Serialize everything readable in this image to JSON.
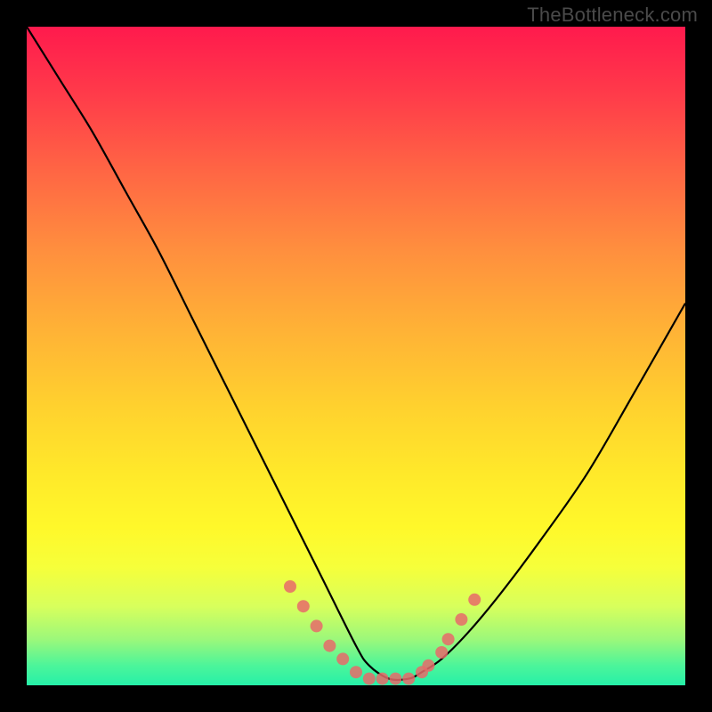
{
  "watermark": "TheBottleneck.com",
  "chart_data": {
    "type": "line",
    "title": "",
    "xlabel": "",
    "ylabel": "",
    "xlim": [
      0,
      100
    ],
    "ylim": [
      0,
      100
    ],
    "background_gradient": {
      "top": "#ff1a4d",
      "middle": "#ffe92a",
      "bottom": "#26f0a8"
    },
    "series": [
      {
        "name": "bottleneck-curve",
        "color": "#000000",
        "x": [
          0,
          5,
          10,
          15,
          20,
          25,
          30,
          35,
          40,
          45,
          50,
          52,
          55,
          58,
          60,
          63,
          67,
          72,
          78,
          85,
          92,
          100
        ],
        "values": [
          100,
          92,
          84,
          75,
          66,
          56,
          46,
          36,
          26,
          16,
          6,
          3,
          1,
          1,
          2,
          4,
          8,
          14,
          22,
          32,
          44,
          58
        ]
      }
    ],
    "markers": {
      "name": "highlight-dots",
      "color": "#e86a6a",
      "x": [
        40,
        42,
        44,
        46,
        48,
        50,
        52,
        54,
        56,
        58,
        60,
        61,
        63,
        64,
        66,
        68
      ],
      "values": [
        15,
        12,
        9,
        6,
        4,
        2,
        1,
        1,
        1,
        1,
        2,
        3,
        5,
        7,
        10,
        13
      ]
    }
  }
}
